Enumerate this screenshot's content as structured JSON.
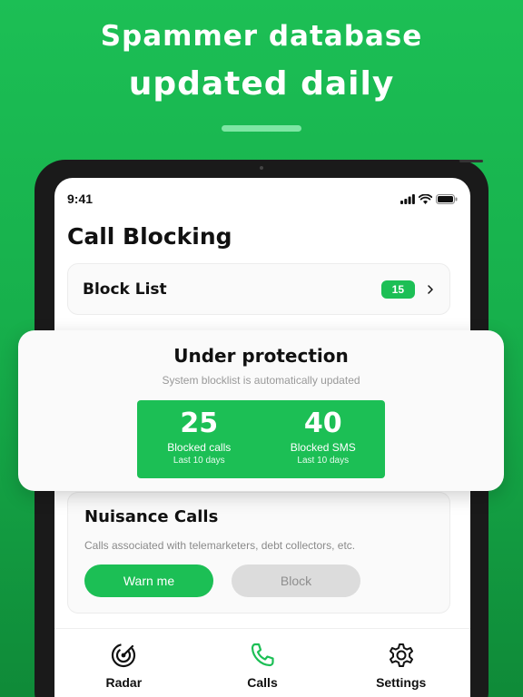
{
  "headline": {
    "line1": "Spammer database",
    "line2": "updated daily"
  },
  "status_bar": {
    "time": "9:41",
    "icons": [
      "signal-icon",
      "wifi-icon",
      "battery-icon"
    ]
  },
  "page_title": "Call Blocking",
  "block_list": {
    "label": "Block List",
    "count": "15",
    "icon": "chevron-right-icon"
  },
  "protection": {
    "title": "Under protection",
    "subtitle": "System blocklist is automatically updated",
    "stats": [
      {
        "value": "25",
        "label": "Blocked calls",
        "period": "Last 10 days"
      },
      {
        "value": "40",
        "label": "Blocked SMS",
        "period": "Last 10 days"
      }
    ]
  },
  "nuisance": {
    "title": "Nuisance Calls",
    "description": "Calls associated with telemarketers, debt collectors, etc.",
    "warn_label": "Warn me",
    "block_label": "Block"
  },
  "tabs": [
    {
      "label": "Radar",
      "icon": "radar-icon"
    },
    {
      "label": "Calls",
      "icon": "phone-icon"
    },
    {
      "label": "Settings",
      "icon": "gear-icon"
    }
  ],
  "colors": {
    "accent": "#1cbf55",
    "background": "#17b04c",
    "inactive_button": "#dcdcdc"
  }
}
